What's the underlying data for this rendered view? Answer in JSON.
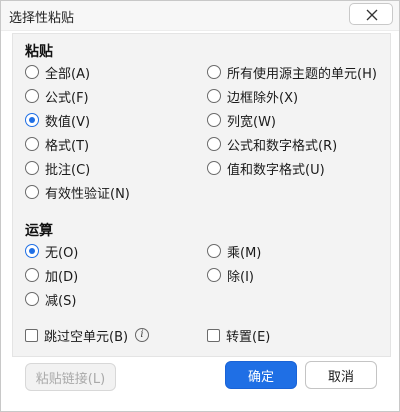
{
  "window": {
    "title": "选择性粘贴"
  },
  "paste": {
    "title": "粘贴",
    "options": [
      {
        "label": "全部(A)",
        "selected": false
      },
      {
        "label": "公式(F)",
        "selected": false
      },
      {
        "label": "数值(V)",
        "selected": true
      },
      {
        "label": "格式(T)",
        "selected": false
      },
      {
        "label": "批注(C)",
        "selected": false
      },
      {
        "label": "有效性验证(N)",
        "selected": false
      },
      {
        "label": "所有使用源主题的单元(H)",
        "selected": false
      },
      {
        "label": "边框除外(X)",
        "selected": false
      },
      {
        "label": "列宽(W)",
        "selected": false
      },
      {
        "label": "公式和数字格式(R)",
        "selected": false
      },
      {
        "label": "值和数字格式(U)",
        "selected": false
      }
    ]
  },
  "operation": {
    "title": "运算",
    "options": [
      {
        "label": "无(O)",
        "selected": true
      },
      {
        "label": "加(D)",
        "selected": false
      },
      {
        "label": "减(S)",
        "selected": false
      },
      {
        "label": "乘(M)",
        "selected": false
      },
      {
        "label": "除(I)",
        "selected": false
      }
    ]
  },
  "checkboxes": {
    "skip_blanks": {
      "label": "跳过空单元(B)",
      "checked": false
    },
    "transpose": {
      "label": "转置(E)",
      "checked": false
    }
  },
  "buttons": {
    "paste_link": "粘贴链接(L)",
    "ok": "确定",
    "cancel": "取消"
  },
  "colors": {
    "accent": "#1f6fe5"
  }
}
